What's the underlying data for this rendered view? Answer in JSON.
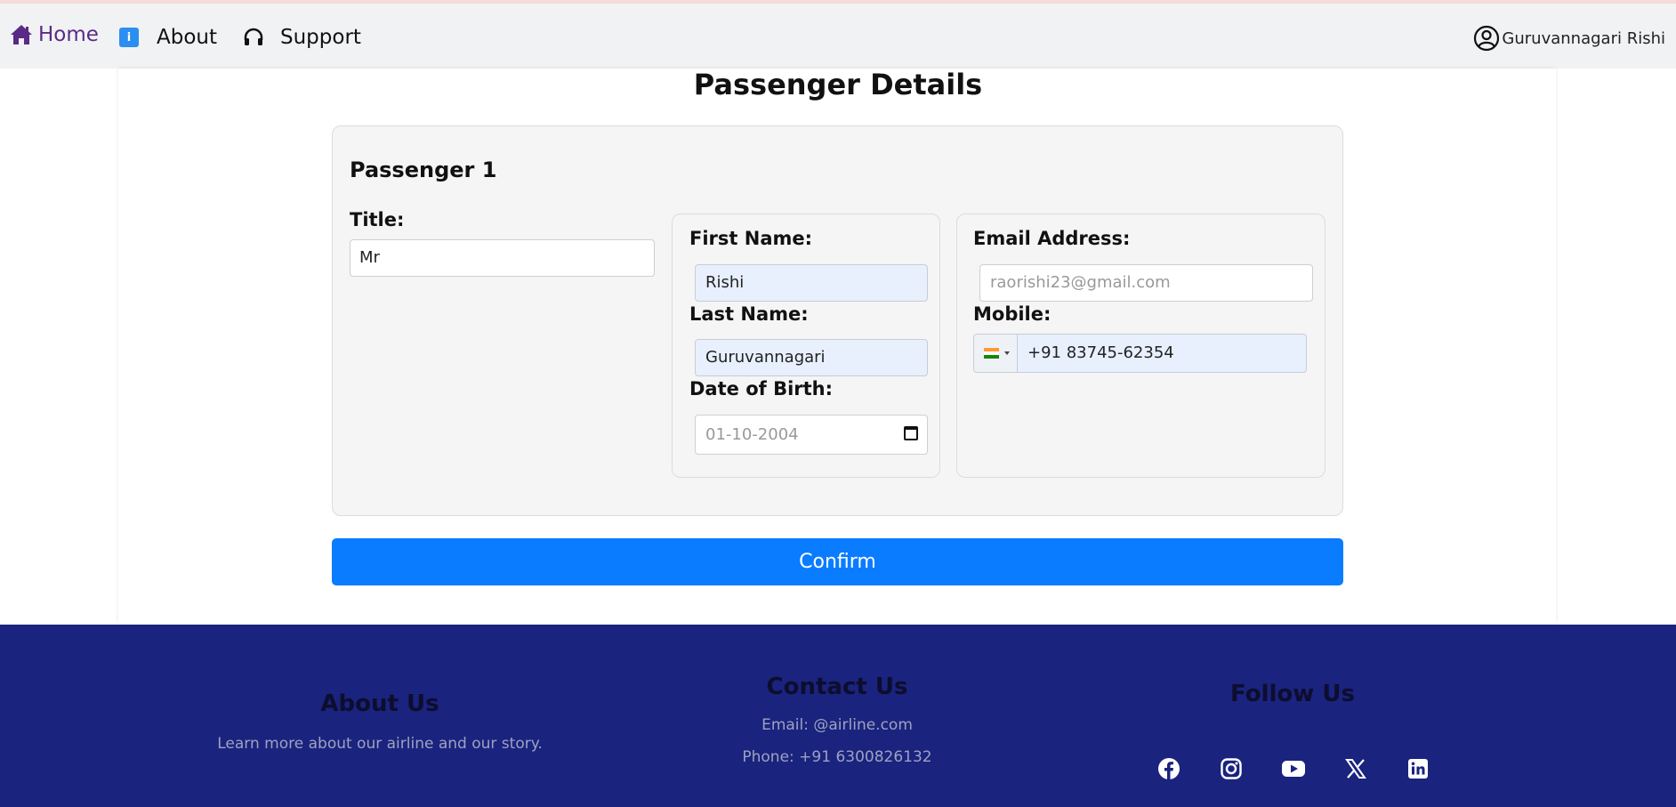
{
  "nav": {
    "home_label": "Home",
    "about_label": "About",
    "support_label": "Support",
    "user_name": "Guruvannagari Rishi",
    "home_color": "#5b2a86"
  },
  "page": {
    "title": "Passenger Details"
  },
  "passenger": {
    "heading": "Passenger 1",
    "title_label": "Title:",
    "title_value": "Mr",
    "first_name_label": "First Name:",
    "first_name_value": "Rishi",
    "last_name_label": "Last Name:",
    "last_name_value": "Guruvannagari",
    "dob_label": "Date of Birth:",
    "dob_value": "01-10-2004",
    "email_label": "Email Address:",
    "email_placeholder": "raorishi23@gmail.com",
    "mobile_label": "Mobile:",
    "mobile_value": "+91 83745-62354",
    "country_flag": "india-flag"
  },
  "confirm_label": "Confirm",
  "colors": {
    "accent": "#0a7cff",
    "footer_bg": "#1a237e"
  },
  "footer": {
    "about": {
      "heading": "About Us",
      "text": "Learn more about our airline and our story."
    },
    "contact": {
      "heading": "Contact Us",
      "email": "Email: @airline.com",
      "phone": "Phone: +91 6300826132"
    },
    "follow": {
      "heading": "Follow Us",
      "icons": [
        "facebook-icon",
        "instagram-icon",
        "youtube-icon",
        "x-icon",
        "linkedin-icon"
      ]
    }
  }
}
